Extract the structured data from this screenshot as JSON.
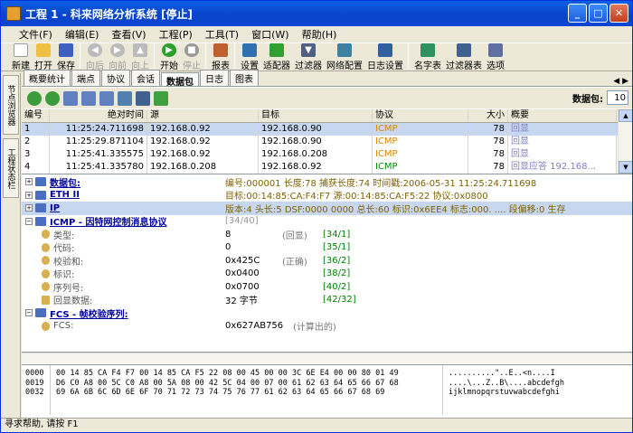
{
  "title": "工程 1 - 科来网络分析系统 [停止]",
  "menu": [
    "文件(F)",
    "编辑(E)",
    "查看(V)",
    "工程(P)",
    "工具(T)",
    "窗口(W)",
    "帮助(H)"
  ],
  "toolbar": {
    "new": "新建",
    "open": "打开",
    "save": "保存",
    "back": "向后",
    "forward": "向前",
    "up": "向上",
    "start": "开始",
    "stop": "停止",
    "report": "报表",
    "settings": "设置",
    "adapter": "适配器",
    "filter": "过滤器",
    "netconfig": "网络配置",
    "logsettings": "日志设置",
    "dictionary": "名字表",
    "filtertable": "过滤器表",
    "options": "选项"
  },
  "sidebar": {
    "tab1": "节点浏览器",
    "tab2": "工程状态栏"
  },
  "tabs": [
    "概要统计",
    "端点",
    "协议",
    "会话",
    "数据包",
    "日志",
    "图表"
  ],
  "packet_count": {
    "label": "数据包:",
    "value": "10"
  },
  "columns": [
    "编号",
    "绝对时间",
    "源",
    "目标",
    "协议",
    "大小",
    "概要"
  ],
  "rows": [
    {
      "no": "1",
      "time": "11:25:24.711698",
      "src": "192.168.0.92",
      "dst": "192.168.0.90",
      "proto": "ICMP",
      "size": "78",
      "summary": "回显"
    },
    {
      "no": "2",
      "time": "11:25:29.871104",
      "src": "192.168.0.92",
      "dst": "192.168.0.90",
      "proto": "ICMP",
      "size": "78",
      "summary": "回显"
    },
    {
      "no": "3",
      "time": "11:25:41.335575",
      "src": "192.168.0.92",
      "dst": "192.168.0.208",
      "proto": "ICMP",
      "size": "78",
      "summary": "回显"
    },
    {
      "no": "4",
      "time": "11:25:41.335780",
      "src": "192.168.0.208",
      "dst": "192.168.0.92",
      "proto": "ICMP",
      "size": "78",
      "summary": "回显应答 192.168..."
    }
  ],
  "decode": {
    "packet": {
      "name": "数据包:",
      "info": "编号:000001 长度:78 捕获长度:74 时间戳:2006-05-31 11:25:24.711698"
    },
    "eth": {
      "name": "ETH II",
      "info": "目标:00:14:85:CA:F4:F7 源:00:14:85:CA:F5:22 协议:0x0800"
    },
    "ip": {
      "name": "IP",
      "info": "版本:4 头长:5 DSF:0000 0000 总长:60 标识:0x6EE4 标志:000. .... 段偏移:0 生存"
    },
    "icmp": {
      "name": "ICMP - 因特网控制消息协议",
      "bits": "[34/40]",
      "fields": [
        {
          "label": "类型:",
          "value": "8",
          "desc": "(回显)",
          "bits": "[34/1]"
        },
        {
          "label": "代码:",
          "value": "0",
          "desc": "",
          "bits": "[35/1]"
        },
        {
          "label": "校验和:",
          "value": "0x425C",
          "desc": "(正确)",
          "bits": "[36/2]"
        },
        {
          "label": "标识:",
          "value": "0x0400",
          "desc": "",
          "bits": "[38/2]"
        },
        {
          "label": "序列号:",
          "value": "0x0700",
          "desc": "",
          "bits": "[40/2]"
        },
        {
          "label": "回显数据:",
          "value": "32 字节",
          "desc": "",
          "bits": "[42/32]"
        }
      ]
    },
    "fcs": {
      "name": "FCS - 帧校验序列:",
      "label": "FCS:",
      "value": "0x627AB756",
      "desc": "(计算出的)"
    }
  },
  "hex": {
    "offsets": [
      "0000",
      "0019",
      "0032"
    ],
    "bytes": [
      "00 14 85 CA F4 F7 00 14 85 CA F5 22 08 00 45 00 00 3C 6E E4 00 00 80 01 49",
      "D6 C0 A8 00 5C C0 A8 00 5A 08 00 42 5C 04 00 07 00 61 62 63 64 65 66 67 68",
      "69 6A 6B 6C 6D 6E 6F 70 71 72 73 74 75 76 77 61 62 63 64 65 66 67 68 69"
    ],
    "ascii": [
      "..........\"..E..<n....I",
      "....\\...Z..B\\....abcdefgh",
      "ijklmnopqrstuvwabcdefghi"
    ]
  },
  "status": "寻求帮助, 请按 F1"
}
